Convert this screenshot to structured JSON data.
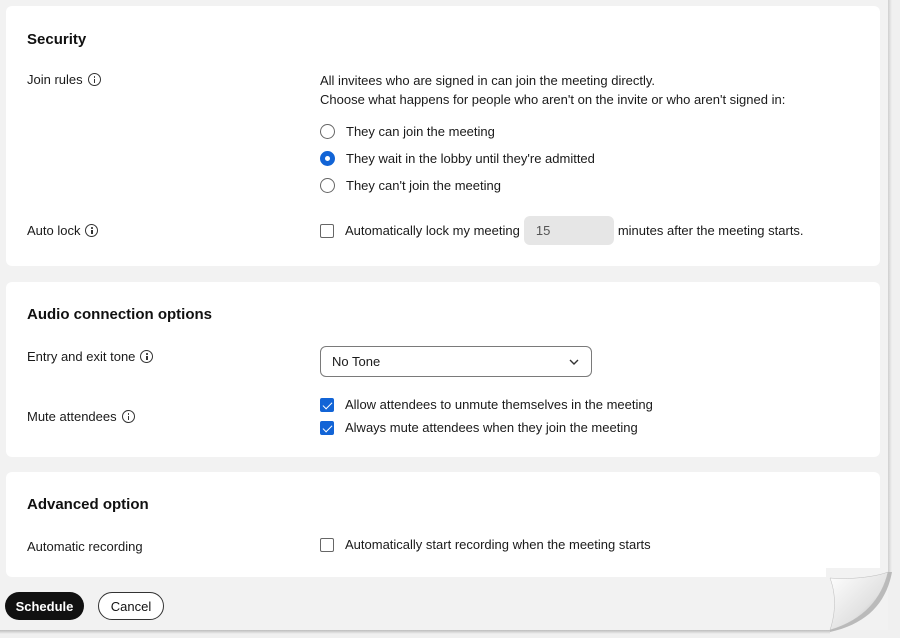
{
  "security": {
    "title": "Security",
    "join_rules": {
      "label": "Join rules",
      "line1": "All invitees who are signed in can join the meeting directly.",
      "line2": "Choose what happens for people who aren't on the invite or who aren't signed in:",
      "options": [
        {
          "label": "They can join the meeting",
          "checked": false
        },
        {
          "label": "They wait in the lobby until they're admitted",
          "checked": true
        },
        {
          "label": "They can't join the meeting",
          "checked": false
        }
      ]
    },
    "auto_lock": {
      "label": "Auto lock",
      "checkbox_label": "Automatically lock my meeting",
      "checked": false,
      "minutes_value": "15",
      "suffix": "minutes after the meeting starts."
    }
  },
  "audio": {
    "title": "Audio connection options",
    "entry_exit_tone": {
      "label": "Entry and exit tone",
      "selected": "No Tone"
    },
    "mute_attendees": {
      "label": "Mute attendees",
      "options": [
        {
          "label": "Allow attendees to unmute themselves in the meeting",
          "checked": true
        },
        {
          "label": "Always mute attendees when they join the meeting",
          "checked": true
        }
      ]
    }
  },
  "advanced": {
    "title": "Advanced option",
    "automatic_recording": {
      "label": "Automatic recording",
      "checkbox_label": "Automatically start recording when the meeting starts",
      "checked": false
    }
  },
  "footer": {
    "schedule_label": "Schedule",
    "cancel_label": "Cancel"
  },
  "colors": {
    "accent": "#1264d6",
    "primary_button": "#111111"
  }
}
